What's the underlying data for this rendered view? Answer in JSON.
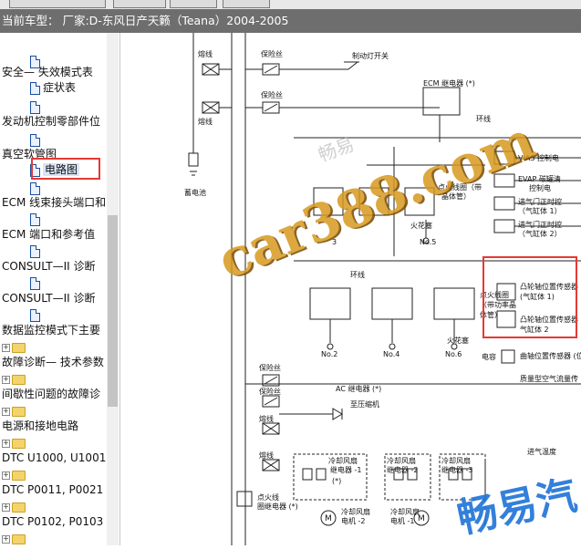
{
  "vehicle_bar": {
    "text": "当前车型： 厂家:D-东风日产天籁（Teana）2004-2005"
  },
  "tree": {
    "items": [
      {
        "label": "",
        "type": "doc"
      },
      {
        "label": "安全— 失效模式表",
        "type": "section"
      },
      {
        "label": "症状表",
        "type": "doc"
      },
      {
        "label": "",
        "type": "doc"
      },
      {
        "label": "发动机控制零部件位",
        "type": "section"
      },
      {
        "label": "",
        "type": "doc"
      },
      {
        "label": "真空软管图",
        "type": "section"
      },
      {
        "label": "电路图",
        "type": "doc",
        "selected": true
      },
      {
        "label": "",
        "type": "doc"
      },
      {
        "label": "ECM 线束接头端口和",
        "type": "section"
      },
      {
        "label": "",
        "type": "doc"
      },
      {
        "label": "ECM 端口和参考值",
        "type": "section"
      },
      {
        "label": "",
        "type": "doc"
      },
      {
        "label": "CONSULT—II 诊断",
        "type": "section"
      },
      {
        "label": "",
        "type": "doc"
      },
      {
        "label": "CONSULT—II 诊断",
        "type": "section"
      },
      {
        "label": "",
        "type": "doc"
      },
      {
        "label": "数据监控模式下主要",
        "type": "section"
      },
      {
        "label": "",
        "type": "folder"
      },
      {
        "label": "故障诊断— 技术参数",
        "type": "section"
      },
      {
        "label": "",
        "type": "folder"
      },
      {
        "label": "间歇性问题的故障诊",
        "type": "section"
      },
      {
        "label": "",
        "type": "folder"
      },
      {
        "label": "电源和接地电路",
        "type": "section"
      },
      {
        "label": "",
        "type": "folder"
      },
      {
        "label": "DTC U1000, U1001",
        "type": "section"
      },
      {
        "label": "",
        "type": "folder"
      },
      {
        "label": "DTC P0011, P0021",
        "type": "section"
      },
      {
        "label": "",
        "type": "folder"
      },
      {
        "label": "DTC P0102, P0103",
        "type": "section"
      },
      {
        "label": "",
        "type": "folder"
      }
    ]
  },
  "diagram": {
    "labels": {
      "fuse1": "熔线",
      "fuse2": "保险丝",
      "brake_switch": "制动灯开关",
      "fuse3": "保险丝",
      "ecm_relay": "ECM 继电器 (*)",
      "fuse4": "熔线",
      "ring1": "环线",
      "battery": "蓄电池",
      "vias": "VIAS 控制电",
      "evap": "EVAP 碳罐清",
      "evap2": "控制电",
      "intake1": "进气门正时控",
      "intake1b": "（气缸体 1）",
      "intake2": "进气门正时控",
      "intake2b": "（气缸体 2）",
      "ignition_coil_a": "点火线圈（带",
      "ignition_coil_a2": "晶体管）",
      "spark_a": "火花塞",
      "no5": "No.5",
      "no3": "3",
      "ring2": "环线",
      "ignition_coil_b": "点火线圈",
      "ignition_coil_b2": "（带功率晶",
      "ignition_coil_b3": "体管）",
      "no2": "No.2",
      "no4": "No.4",
      "no6": "No.6",
      "spark_b": "火花塞",
      "cam1": "凸轮轴位置传感器",
      "cam1b": "(气缸体 1)",
      "cam2": "凸轮轴位置传感器",
      "cam2b": "气缸体 2",
      "capacitor": "电容",
      "crank": "曲轴位置传感器 (位",
      "fuse5": "保险丝",
      "maf": "质量型空气流量传",
      "fuse6": "保险丝",
      "ac_relay": "AC 继电器 (*)",
      "compressor": "至压缩机",
      "fuse7": "熔线",
      "fuse8": "熔线",
      "fan_relay1": "冷却风扇",
      "fan_relay1b": "继电器 -1",
      "fan_relay2": "冷却风扇",
      "fan_relay2b": "继电器 -2",
      "fan_relay3": "冷却风扇",
      "fan_relay3b": "继电器 -3",
      "ignition_relay": "点火线",
      "ignition_relay2": "圈继电器 (*)",
      "fan_motor2": "冷却风扇",
      "fan_motor2b": "电机 -2",
      "fan_motor1": "冷却风扇",
      "fan_motor1b": "电机 -1",
      "star": "(*)",
      "inlet_temp": "进气温度"
    }
  },
  "watermarks": {
    "big": "car388.com",
    "small": "畅易",
    "corner": "畅易汽",
    "url": "car388.com"
  },
  "colors": {
    "highlight": "#e53935",
    "folder": "#f4d36b",
    "header_bg": "#6e6e6e"
  }
}
